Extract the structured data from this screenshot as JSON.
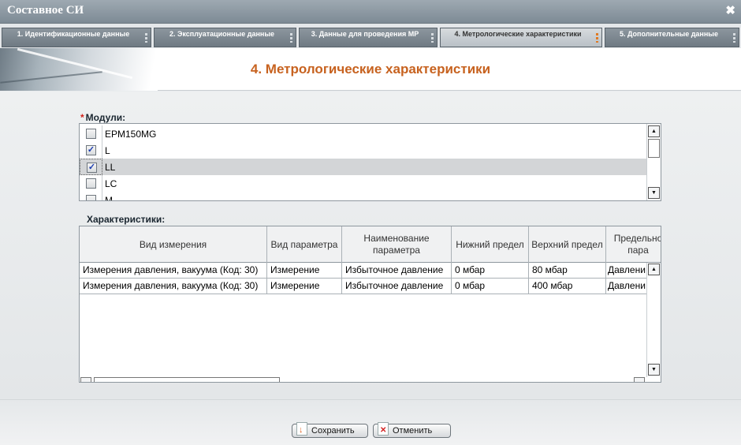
{
  "window": {
    "title": "Составное СИ",
    "close_icon": "close-icon"
  },
  "tabs": [
    {
      "label": "1. Идентификационные данные",
      "active": false
    },
    {
      "label": "2. Эксплуатационные данные",
      "active": false
    },
    {
      "label": "3. Данные для проведения МР",
      "active": false
    },
    {
      "label": "4. Метрологические характеристики",
      "active": true
    },
    {
      "label": "5. Дополнительные данные",
      "active": false
    }
  ],
  "page": {
    "heading": "4. Метрологические характеристики"
  },
  "modules": {
    "label": "Модули:",
    "required_mark": "*",
    "items": [
      {
        "name": "EPM150MG",
        "checked": false,
        "selected": false
      },
      {
        "name": "L",
        "checked": true,
        "selected": false
      },
      {
        "name": "LL",
        "checked": true,
        "selected": true
      },
      {
        "name": "LC",
        "checked": false,
        "selected": false
      },
      {
        "name": "M",
        "checked": false,
        "selected": false
      }
    ]
  },
  "characteristics": {
    "label": "Характеристики:",
    "columns": [
      "Вид измерения",
      "Вид параметра",
      "Наименование параметра",
      "Нижний предел",
      "Верхний предел",
      "Предельно пара"
    ],
    "rows": [
      [
        "Измерения давления, вакуума (Код: 30)",
        "Измерение",
        "Избыточное давление",
        "0 мбар",
        "80 мбар",
        "Давлени"
      ],
      [
        "Измерения давления, вакуума (Код: 30)",
        "Измерение",
        "Избыточное давление",
        "0 мбар",
        "400 мбар",
        "Давлени"
      ]
    ]
  },
  "buttons": {
    "save": "Сохранить",
    "cancel": "Отменить"
  },
  "colors": {
    "accent": "#c7621f",
    "titlebar": "#8a96a0",
    "selected_row": "#d3d5d7"
  }
}
